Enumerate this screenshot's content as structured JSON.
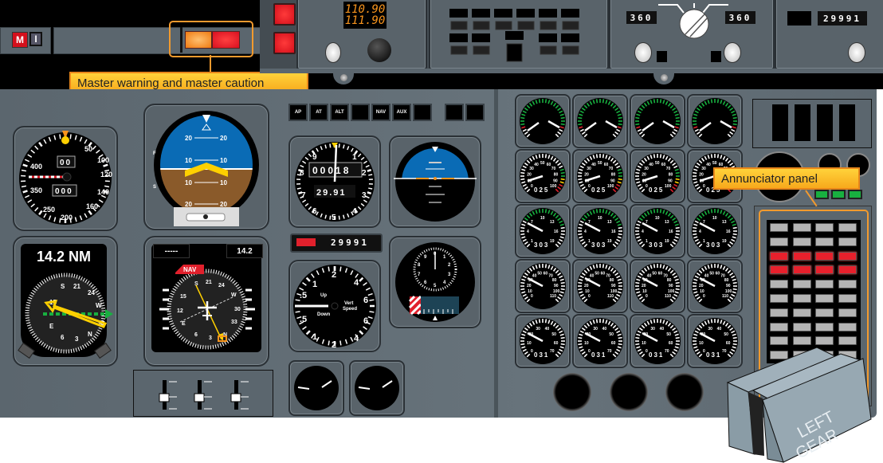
{
  "callouts": {
    "master": "Master warning and master caution",
    "annunciator": "Annunciator panel"
  },
  "glareshield": {
    "m_button": "M",
    "i_button": "I",
    "master_caution_color": "#f7941d",
    "master_warning_color": "#e8202c"
  },
  "nav_radio": {
    "active_freq": "110.90",
    "standby_freq": "111.90"
  },
  "course_panel": {
    "left_course": "360",
    "right_course": "360"
  },
  "altitude_select": {
    "value": "29991"
  },
  "autopilot_buttons": [
    "AP",
    "AT",
    "ALT",
    "",
    "NAV",
    "AUX",
    "",
    "",
    ""
  ],
  "airspeed": {
    "ticks": [
      "50",
      "100",
      "120",
      "140",
      "160",
      "200",
      "250",
      "350",
      "400"
    ],
    "mach_counter": "00",
    "speed_counter": "000"
  },
  "attitude": {
    "pitch_labels": [
      "20",
      "10",
      "10",
      "20"
    ],
    "side_marks": [
      "F",
      "S"
    ]
  },
  "altimeter": {
    "ticks": [
      "9",
      "1",
      "2",
      "3",
      "4",
      "5",
      "6",
      "7",
      "8"
    ],
    "altitude_counter": "00018",
    "baro_counter": "29.91"
  },
  "rmi": {
    "distance": "14.2 NM",
    "labels": [
      "S",
      "21",
      "24",
      "W",
      "15",
      "E",
      "6",
      "3",
      "N",
      "33"
    ]
  },
  "hsi": {
    "left_readout": "-----",
    "right_readout": "14.2",
    "nav_flag": "NAV",
    "labels": [
      "S",
      "21",
      "24",
      "W",
      "30",
      "33",
      "N",
      "3",
      "6",
      "E",
      "12",
      "15"
    ]
  },
  "altitude_alert": {
    "value": "29991"
  },
  "vertical_speed": {
    "ticks": [
      "2",
      "4",
      "6",
      "6",
      "4",
      "2",
      "1",
      ".5",
      ".5",
      "1"
    ],
    "up_label": "Up",
    "down_label": "Down",
    "title_line1": "Vert",
    "title_line2": "Speed"
  },
  "standby": {
    "ticks": [
      "0",
      "1",
      "2",
      "3",
      "4",
      "5",
      "6",
      "7",
      "8",
      "9"
    ]
  },
  "engine_gauges": {
    "row2_counter": "025",
    "row2_ticks": [
      "0",
      "10",
      "20",
      "30",
      "40",
      "50",
      "60",
      "70",
      "80",
      "90",
      "100"
    ],
    "row3_counter": "303",
    "row3_ticks": [
      "1",
      "4",
      "7",
      "10",
      "13",
      "16",
      "19"
    ],
    "row4_ticks": [
      "0",
      "10",
      "20",
      "30",
      "40",
      "50",
      "60",
      "70",
      "80",
      "90",
      "100",
      "110"
    ],
    "row5_counter": "031",
    "row5_ticks": [
      "0",
      "10",
      "20",
      "30",
      "40",
      "50",
      "60",
      "70"
    ]
  },
  "annunciator": {
    "rows": 10,
    "cols": 4,
    "red_rows": [
      2,
      3
    ]
  },
  "gear_button": {
    "line1": "LEFT",
    "line2": "GEAR"
  }
}
